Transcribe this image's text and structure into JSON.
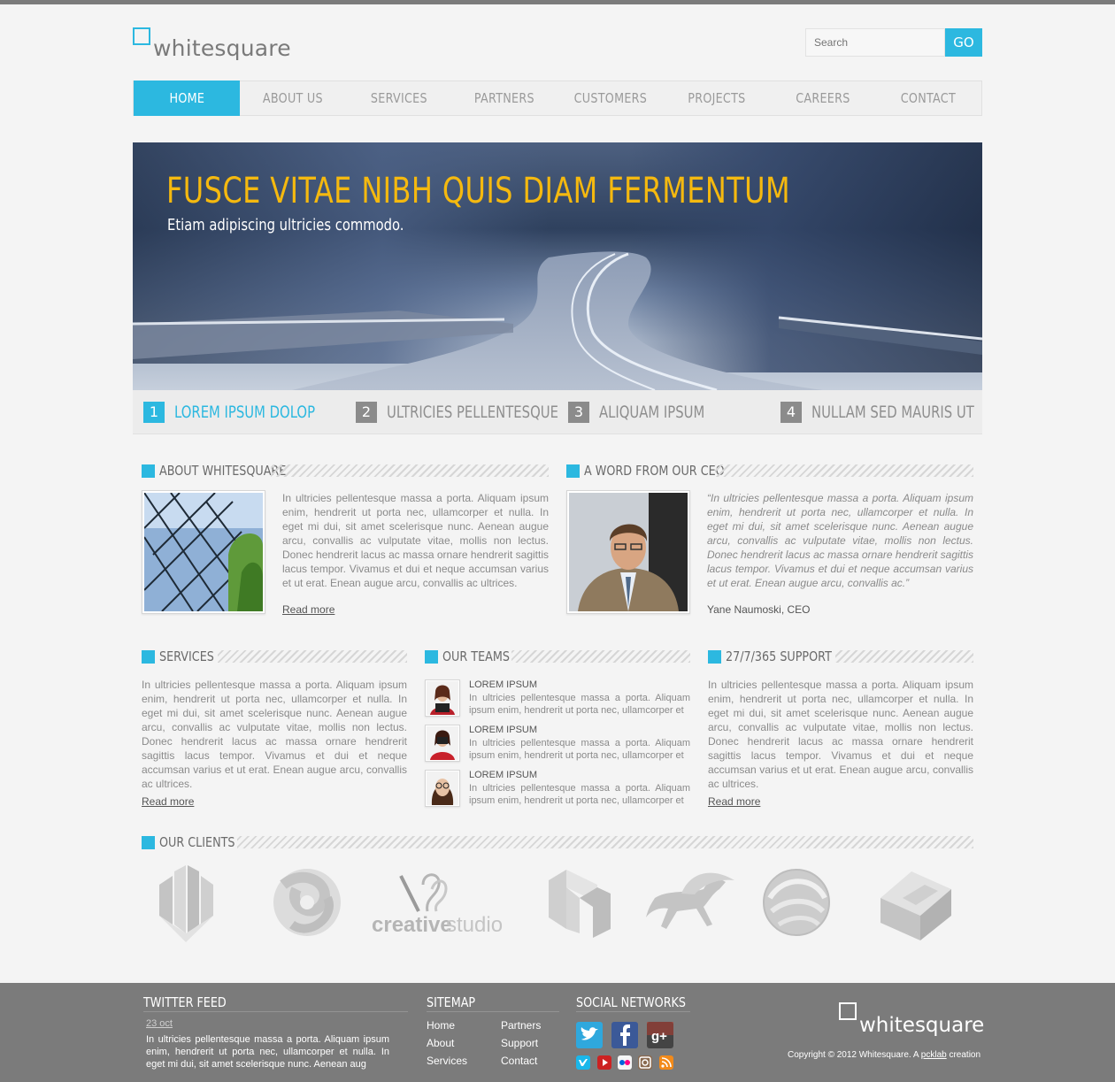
{
  "brand": {
    "name": "whitesquare"
  },
  "search": {
    "placeholder": "Search",
    "button": "GO"
  },
  "nav": [
    "HOME",
    "ABOUT US",
    "SERVICES",
    "PARTNERS",
    "CUSTOMERS",
    "PROJECTS",
    "CAREERS",
    "CONTACT"
  ],
  "hero": {
    "title": "FUSCE VITAE NIBH QUIS DIAM FERMENTUM",
    "subtitle": "Etiam adipiscing ultricies commodo."
  },
  "slider_tabs": [
    {
      "num": "1",
      "label": "LOREM IPSUM DOLOP"
    },
    {
      "num": "2",
      "label": "ULTRICIES PELLENTESQUE"
    },
    {
      "num": "3",
      "label": "ALIQUAM IPSUM"
    },
    {
      "num": "4",
      "label": "NULLAM SED MAURIS UT"
    }
  ],
  "about": {
    "heading": "ABOUT WHITESQUARE",
    "text": "In ultricies pellentesque massa a porta. Aliquam ipsum enim, hendrerit ut porta nec, ullamcorper et nulla. In eget mi dui, sit amet scelerisque nunc. Aenean augue arcu, convallis ac vulputate vitae, mollis non lectus. Donec hendrerit lacus ac massa ornare hendrerit sagittis lacus tempor. Vivamus et dui et neque accumsan varius et ut erat. Enean augue arcu, convallis ac ultrices.",
    "read_more": "Read more"
  },
  "ceo": {
    "heading": "A WORD FROM OUR CEO",
    "quote": "“In ultricies pellentesque massa a porta. Aliquam ipsum enim, hendrerit ut porta nec, ullamcorper et nulla. In eget mi dui, sit amet scelerisque nunc. Aenean augue arcu, convallis ac vulputate vitae, mollis non lectus. Donec hendrerit lacus ac massa ornare hendrerit sagittis lacus tempor. Vivamus et dui et neque accumsan varius et ut erat. Enean augue arcu, convallis ac.”",
    "author": "Yane Naumoski, CEO"
  },
  "services": {
    "heading": "SERVICES",
    "text": "In ultricies pellentesque massa a porta. Aliquam ipsum enim, hendrerit ut porta nec, ullamcorper et nulla. In eget mi dui, sit amet scelerisque nunc. Aenean augue arcu, convallis ac vulputate vitae, mollis non lectus. Donec hendrerit lacus ac massa ornare hendrerit sagittis lacus tempor. Vivamus et dui et neque accumsan varius et ut erat. Enean augue arcu, convallis ac ultrices.",
    "read_more": "Read more"
  },
  "teams": {
    "heading": "OUR TEAMS",
    "members": [
      {
        "name": "LOREM IPSUM",
        "text": "In ultricies pellentesque massa a porta. Aliquam ipsum enim, hendrerit ut porta nec, ullamcorper et"
      },
      {
        "name": "LOREM IPSUM",
        "text": "In ultricies pellentesque massa a porta. Aliquam ipsum enim, hendrerit ut porta nec, ullamcorper et"
      },
      {
        "name": "LOREM IPSUM",
        "text": "In ultricies pellentesque massa a porta. Aliquam ipsum enim, hendrerit ut porta nec, ullamcorper et"
      }
    ]
  },
  "support": {
    "heading": "27/7/365 SUPPORT",
    "text": "In ultricies pellentesque massa a porta. Aliquam ipsum enim, hendrerit ut porta nec, ullamcorper et nulla. In eget mi dui, sit amet scelerisque nunc. Aenean augue arcu, convallis ac vulputate vitae, mollis non lectus. Donec hendrerit lacus ac massa ornare hendrerit sagittis lacus tempor. Vivamus et dui et neque accumsan varius et ut erat. Enean augue arcu, convallis ac ultrices.",
    "read_more": "Read more"
  },
  "clients": {
    "heading": "OUR CLIENTS",
    "logos": [
      "w-logo-icon",
      "knot-logo-icon",
      "creativestudio-logo-icon",
      "cube-n-logo-icon",
      "pegasus-logo-icon",
      "sphere-logo-icon",
      "puzzle-cube-logo-icon"
    ],
    "creative_studio_text_a": "creative",
    "creative_studio_text_b": "studio"
  },
  "footer": {
    "twitter": {
      "heading": "TWITTER FEED",
      "date": "23 oct",
      "text": "In ultricies pellentesque massa a porta. Aliquam ipsum enim, hendrerit ut porta nec, ullamcorper et nulla. In eget mi dui, sit amet scelerisque nunc. Aenean aug"
    },
    "sitemap": {
      "heading": "SITEMAP",
      "col1": [
        "Home",
        "About",
        "Services"
      ],
      "col2": [
        "Partners",
        "Support",
        "Contact"
      ]
    },
    "social": {
      "heading": "SOCIAL NETWORKS"
    },
    "brand": "whitesquare",
    "copyright_pre": "Copyright © 2012 Whitesquare. A ",
    "copyright_link": "pcklab",
    "copyright_post": " creation"
  },
  "colors": {
    "accent": "#2cb8e0",
    "hero_title": "#f5b90f",
    "footer_bg": "#7b7b7b"
  }
}
